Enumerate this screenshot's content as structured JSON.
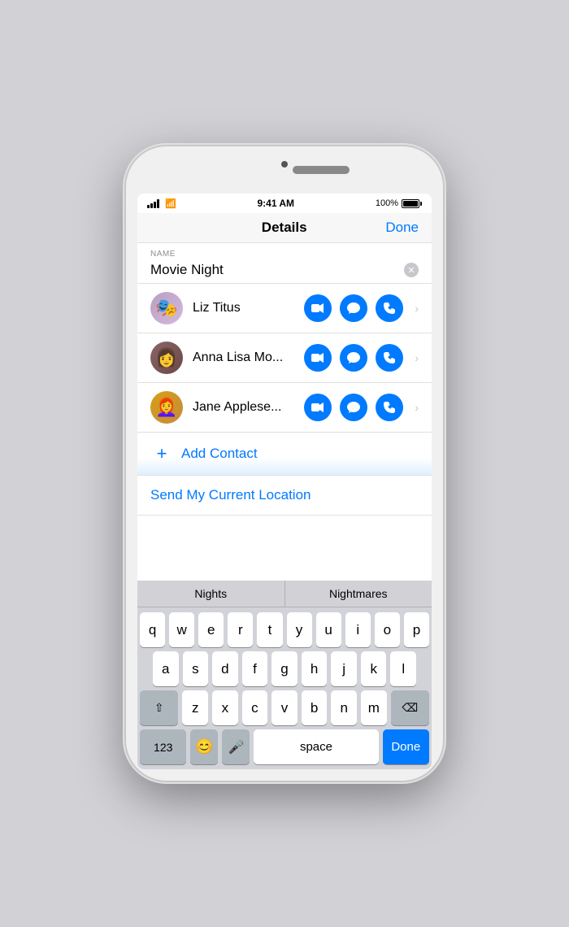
{
  "phone": {
    "status_bar": {
      "time": "9:41 AM",
      "battery_percent": "100%"
    },
    "nav": {
      "title": "Details",
      "done_label": "Done"
    },
    "name_section": {
      "label": "NAME",
      "value": "Movie Night",
      "placeholder": "Name"
    },
    "contacts": [
      {
        "id": "liz",
        "name": "Liz Titus",
        "avatar_type": "avatar-liz",
        "avatar_emoji": "🎭"
      },
      {
        "id": "anna",
        "name": "Anna Lisa Mo...",
        "avatar_type": "avatar-anna",
        "avatar_emoji": "👩"
      },
      {
        "id": "jane",
        "name": "Jane Applese...",
        "avatar_type": "avatar-jane",
        "avatar_emoji": "👩‍🦰"
      }
    ],
    "add_contact": {
      "label": "Add Contact",
      "plus_symbol": "+"
    },
    "send_location": {
      "label": "Send My Current Location"
    },
    "autocomplete": {
      "suggestions": [
        "Nights",
        "Nightmares"
      ]
    },
    "keyboard": {
      "rows": [
        [
          "q",
          "w",
          "e",
          "r",
          "t",
          "y",
          "u",
          "i",
          "o",
          "p"
        ],
        [
          "a",
          "s",
          "d",
          "f",
          "g",
          "h",
          "j",
          "k",
          "l"
        ],
        [
          "z",
          "x",
          "c",
          "v",
          "b",
          "n",
          "m"
        ]
      ],
      "bottom": {
        "numbers": "123",
        "emoji": "😊",
        "mic": "🎤",
        "space": "space",
        "done": "Done"
      }
    },
    "action_buttons": {
      "video": "📹",
      "message": "💬",
      "phone": "📞"
    }
  }
}
